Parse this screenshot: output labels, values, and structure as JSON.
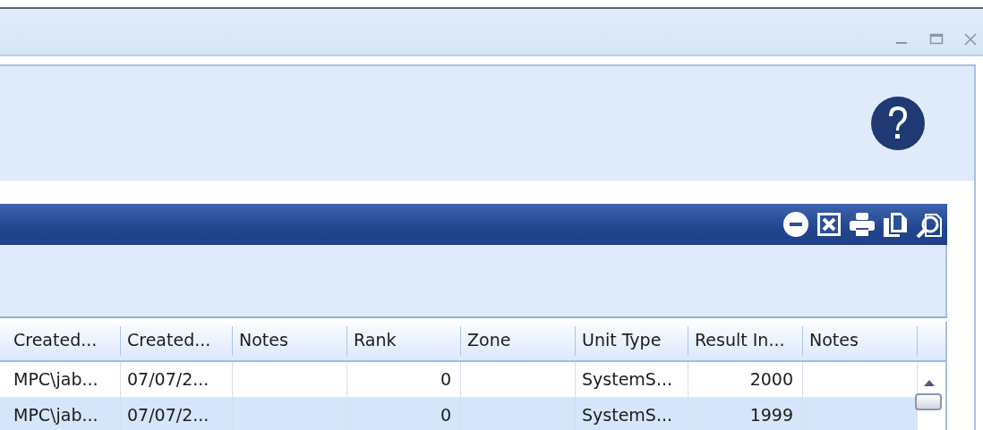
{
  "window": {
    "controls": [
      {
        "kind": "minimize"
      },
      {
        "kind": "maximize"
      },
      {
        "kind": "close"
      }
    ]
  },
  "grid": {
    "toolbar": [
      {
        "kind": "collapse"
      },
      {
        "kind": "excel"
      },
      {
        "kind": "print"
      },
      {
        "kind": "copy"
      },
      {
        "kind": "preview"
      }
    ],
    "columns": [
      {
        "label": "Created...",
        "kind": "text"
      },
      {
        "label": "Created...",
        "kind": "text"
      },
      {
        "label": "Notes",
        "kind": "text"
      },
      {
        "label": "Rank",
        "kind": "number"
      },
      {
        "label": "Zone",
        "kind": "text"
      },
      {
        "label": "Unit Type",
        "kind": "text"
      },
      {
        "label": "Result In...",
        "kind": "number"
      },
      {
        "label": "Notes",
        "kind": "text"
      }
    ],
    "rows": [
      {
        "selected": false,
        "cells": [
          "MPC\\jab...",
          "07/07/2...",
          "",
          "0",
          "",
          "SystemS...",
          "2000",
          ""
        ]
      },
      {
        "selected": true,
        "cells": [
          "MPC\\jab...",
          "07/07/2...",
          "",
          "0",
          "",
          "SystemS...",
          "1999",
          ""
        ]
      }
    ]
  }
}
